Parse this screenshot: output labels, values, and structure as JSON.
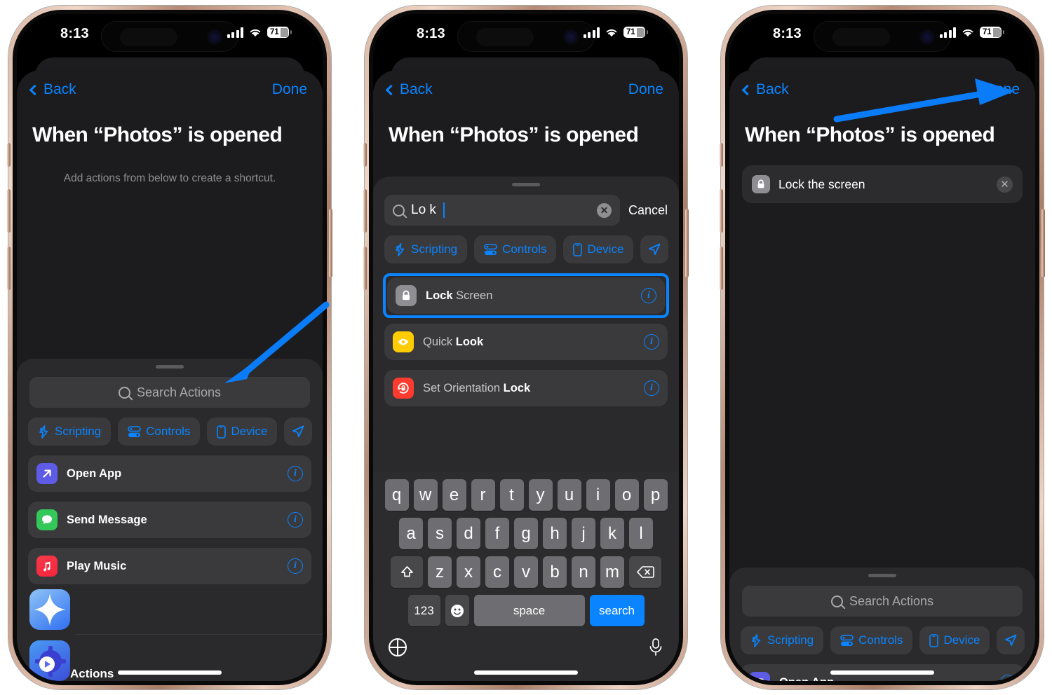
{
  "statusbar": {
    "time": "8:13",
    "battery_level": "71",
    "signal_icon": "cellular-signal-icon",
    "wifi_icon": "wifi-icon",
    "battery_icon": "battery-icon"
  },
  "nav": {
    "back_label": "Back",
    "done_label": "Done",
    "back_icon": "chevron-left-icon"
  },
  "page_title": "When “Photos” is opened",
  "phone1": {
    "subtitle": "Add actions from below to create a shortcut.",
    "drawer": {
      "search_placeholder": "Search Actions",
      "search_icon": "search-icon",
      "grabber": "drag-grabber",
      "categories": [
        {
          "label": "Scripting",
          "icon": "scripting-icon"
        },
        {
          "label": "Controls",
          "icon": "controls-icon"
        },
        {
          "label": "Device",
          "icon": "device-icon"
        },
        {
          "label": "",
          "icon": "location-arrow-icon"
        }
      ],
      "actions": [
        {
          "label": "Open App",
          "icon": "open-app-icon",
          "icon_color": "#5e5ce6",
          "info_icon": "info-icon"
        },
        {
          "label": "Send Message",
          "icon": "messages-icon",
          "icon_color": "#34c759",
          "info_icon": "info-icon"
        },
        {
          "label": "Play Music",
          "icon": "music-icon",
          "icon_color": "#fa2e47",
          "info_icon": "info-icon"
        }
      ],
      "app_rows": [
        {
          "icon": "shortcuts-app-icon",
          "label": ""
        },
        {
          "icon": "automation-gear-play-icon",
          "label": "Actions"
        }
      ]
    },
    "annotation": {
      "arrow": "pointer-arrow-to-search",
      "color": "#0a84ff"
    }
  },
  "phone2": {
    "search": {
      "value": "Lo k",
      "search_icon": "search-icon",
      "clear_icon": "clear-text-icon",
      "cancel_label": "Cancel"
    },
    "categories": [
      {
        "label": "Scripting",
        "icon": "scripting-icon"
      },
      {
        "label": "Controls",
        "icon": "controls-icon"
      },
      {
        "label": "Device",
        "icon": "device-icon"
      },
      {
        "label": "",
        "icon": "location-arrow-icon"
      }
    ],
    "results": [
      {
        "bold": "Lock",
        "rest": " Screen",
        "icon": "lock-icon",
        "icon_color": "#8e8e93",
        "info_icon": "info-icon",
        "highlighted": true
      },
      {
        "bold": "Quick",
        "rest": " Look",
        "bold_first": false,
        "icon": "quick-look-eye-icon",
        "icon_color": "#ffcc00",
        "info_icon": "info-icon",
        "highlighted": false
      },
      {
        "bold": "Set Orientation",
        "rest": " Lock",
        "icon": "orientation-lock-icon",
        "icon_color": "#ff3b30",
        "info_icon": "info-icon",
        "highlighted": false
      }
    ],
    "keyboard": {
      "row1": [
        "q",
        "w",
        "e",
        "r",
        "t",
        "y",
        "u",
        "i",
        "o",
        "p"
      ],
      "row2": [
        "a",
        "s",
        "d",
        "f",
        "g",
        "h",
        "j",
        "k",
        "l"
      ],
      "row3": [
        "z",
        "x",
        "c",
        "v",
        "b",
        "n",
        "m"
      ],
      "shift_icon": "shift-key-icon",
      "backspace_icon": "backspace-key-icon",
      "numbers_label": "123",
      "emoji_icon": "emoji-key-icon",
      "space_label": "space",
      "return_label": "search",
      "globe_icon": "globe-key-icon",
      "mic_icon": "microphone-icon"
    }
  },
  "phone3": {
    "action": {
      "label": "Lock the screen",
      "icon": "lock-icon",
      "remove_icon": "remove-action-icon"
    },
    "drawer": {
      "search_placeholder": "Search Actions",
      "search_icon": "search-icon",
      "categories": [
        {
          "label": "Scripting",
          "icon": "scripting-icon"
        },
        {
          "label": "Controls",
          "icon": "controls-icon"
        },
        {
          "label": "Device",
          "icon": "device-icon"
        },
        {
          "label": "",
          "icon": "location-arrow-icon"
        }
      ],
      "actions": [
        {
          "label": "Open App",
          "icon": "open-app-icon",
          "icon_color": "#5e5ce6",
          "info_icon": "info-icon"
        }
      ]
    },
    "annotation": {
      "arrow": "pointer-arrow-to-done",
      "color": "#0a84ff"
    }
  },
  "colors": {
    "accent_blue": "#0a84ff",
    "sheet_bg": "#1c1c1e",
    "drawer_bg": "#2a2a2c",
    "row_bg": "#3a3a3c",
    "frame": "#c8a08c"
  }
}
